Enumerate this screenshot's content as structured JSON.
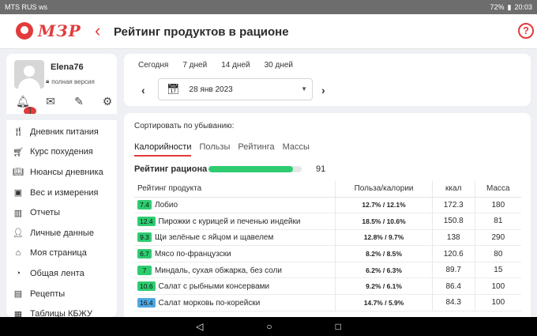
{
  "status": {
    "carrier": "MTS RUS",
    "extra": "ws",
    "battery": "72%",
    "time": "20:03"
  },
  "header": {
    "logo_text": "МЗР",
    "title": "Рейтинг продуктов в рационе",
    "help": "?"
  },
  "profile": {
    "name": "Elena76",
    "version": "полная версия",
    "notifications": "1"
  },
  "nav": [
    {
      "label": "Дневник питания",
      "icon": "utensils-icon"
    },
    {
      "label": "Курс похудения",
      "icon": "cart-icon"
    },
    {
      "label": "Нюансы дневника",
      "icon": "book-icon"
    },
    {
      "label": "Вес и измерения",
      "icon": "scale-icon"
    },
    {
      "label": "Отчеты",
      "icon": "bar-chart-icon"
    },
    {
      "label": "Личные данные",
      "icon": "user-icon"
    },
    {
      "label": "Моя страница",
      "icon": "home-icon"
    },
    {
      "label": "Общая лента",
      "icon": "rss-icon"
    },
    {
      "label": "Рецепты",
      "icon": "recipe-icon"
    },
    {
      "label": "Таблицы КБЖУ",
      "icon": "table-icon"
    }
  ],
  "date": {
    "quick": [
      "Сегодня",
      "7 дней",
      "14 дней",
      "30 дней"
    ],
    "selected": "28 янв 2023"
  },
  "main": {
    "sort_label": "Сортировать по убыванию:",
    "tabs": [
      "Калорийности",
      "Пользы",
      "Рейтинга",
      "Массы"
    ],
    "rating_label": "Рейтинг рациона",
    "rating_value": 91,
    "columns": [
      "Рейтинг продукта",
      "Польза/калории",
      "ккал",
      "Масса"
    ],
    "rows": [
      {
        "score": "7.4",
        "color": "#2ecc71",
        "name": "Лобио",
        "pk": "12.7% / 12.1%",
        "kcal": "172.3",
        "mass": "180"
      },
      {
        "score": "12.4",
        "color": "#2ecc71",
        "name": "Пирожки с курицей и печенью индейки",
        "pk": "18.5% / 10.6%",
        "kcal": "150.8",
        "mass": "81"
      },
      {
        "score": "9.3",
        "color": "#2ecc71",
        "name": "Щи зелёные с яйцом и щавелем",
        "pk": "12.8% / 9.7%",
        "kcal": "138",
        "mass": "290"
      },
      {
        "score": "6.7",
        "color": "#2ecc71",
        "name": "Мясо по-французски",
        "pk": "8.2% / 8.5%",
        "kcal": "120.6",
        "mass": "80"
      },
      {
        "score": "7",
        "color": "#2ecc71",
        "name": "Миндаль, сухая обжарка, без соли",
        "pk": "6.2% / 6.3%",
        "kcal": "89.7",
        "mass": "15"
      },
      {
        "score": "10.6",
        "color": "#2ecc71",
        "name": "Салат с рыбными консервами",
        "pk": "9.2% / 6.1%",
        "kcal": "86.4",
        "mass": "100"
      },
      {
        "score": "16.4",
        "color": "#4fa8e0",
        "name": "Салат морковь по-корейски",
        "pk": "14.7% / 5.9%",
        "kcal": "84.3",
        "mass": "100"
      }
    ]
  }
}
